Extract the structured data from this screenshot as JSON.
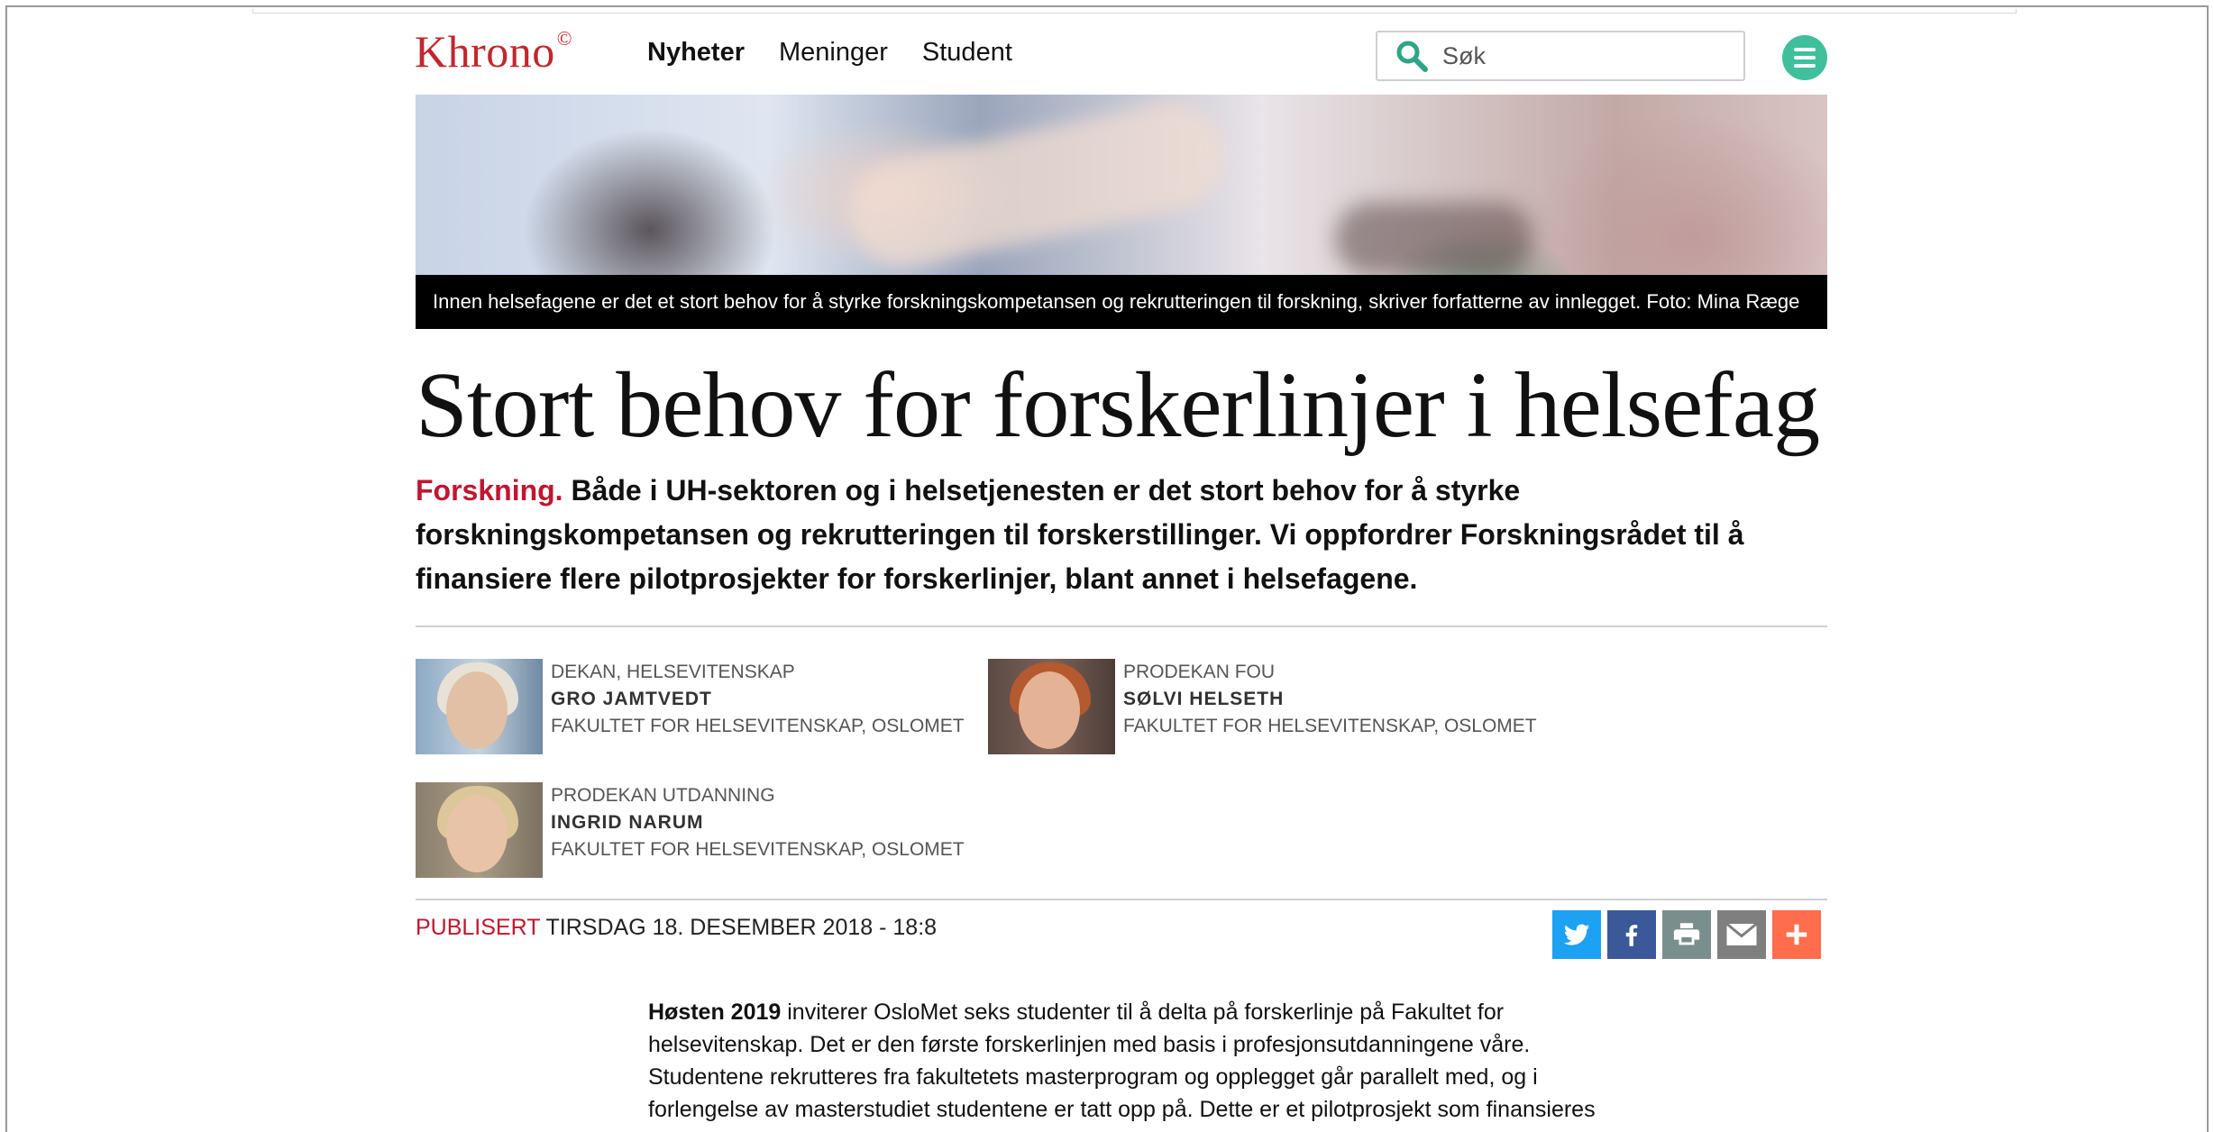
{
  "header": {
    "logo_text": "Khrono",
    "logo_mark": "©",
    "nav": [
      "Nyheter",
      "Meninger",
      "Student"
    ],
    "search_placeholder": "Søk"
  },
  "hero": {
    "caption": "Innen helsefagene er det et stort behov for å styrke forskningskompetansen og rekrutteringen til forskning, skriver forfatterne av innlegget. Foto: Mina Ræge"
  },
  "article": {
    "title": "Stort behov for forskerlinjer i helsefag",
    "kicker": "Forskning.",
    "ingress": "Både i UH-sektoren og i helsetjenesten er det stort behov for å styrke forskningskompetansen og rekrutteringen til forskerstillinger. Vi oppfordrer Forskningsrådet til å finansiere flere pilotprosjekter for forskerlinjer, blant annet i helsefagene.",
    "authors": [
      {
        "role": "DEKAN, HELSEVITENSKAP",
        "name": "GRO JAMTVEDT",
        "org": "FAKULTET FOR HELSEVITENSKAP, OSLOMET"
      },
      {
        "role": "PRODEKAN FOU",
        "name": "SØLVI HELSETH",
        "org": "FAKULTET FOR HELSEVITENSKAP, OSLOMET"
      },
      {
        "role": "PRODEKAN UTDANNING",
        "name": "INGRID NARUM",
        "org": "FAKULTET FOR HELSEVITENSKAP, OSLOMET"
      }
    ],
    "published_label": "PUBLISERT",
    "published_date": "TIRSDAG 18. DESEMBER 2018 - 18:8",
    "body_lead": "Høsten 2019",
    "body_text": " inviterer OsloMet seks studenter til å delta på forskerlinje på Fakultet for helsevitenskap. Det er den første forskerlinjen med basis i profesjonsutdanningene våre. Studentene rekrutteres fra fakultetets masterprogram og opplegget går parallelt med, og i forlengelse av masterstudiet studentene er tatt opp på. Dette er et pilotprosjekt som finansieres"
  },
  "share": [
    "twitter-icon",
    "facebook-icon",
    "print-icon",
    "email-icon",
    "plus-icon"
  ],
  "colors": {
    "brand_red": "#c1162f",
    "menu_green": "#3fbf9b",
    "twitter": "#1da1f2",
    "facebook": "#3b5998",
    "print": "#7b8e8e",
    "email": "#7f7f7f",
    "plus": "#ff6d4c"
  }
}
